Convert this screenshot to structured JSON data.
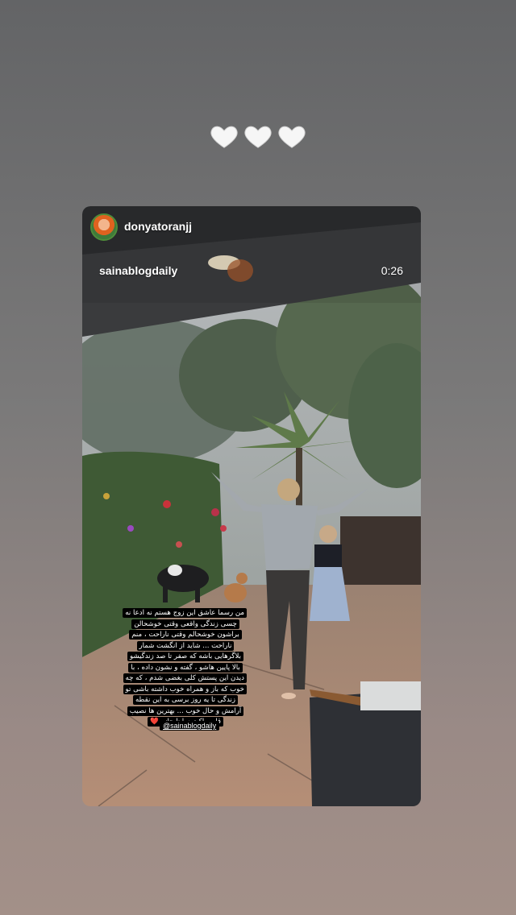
{
  "story": {
    "top_emojis": [
      "white-heart",
      "white-heart",
      "white-heart"
    ],
    "shared_post": {
      "username": "donyatoranjj",
      "source_account": "sainablogdaily",
      "timer": "0:26",
      "caption": "من رسما عاشق این زوج هستم نه ادعا نه چسی زندگی واقعی وقتی خوشحالن براشون خوشحالم وقتی ناراحت ، منم ناراحت ... شاید از انگشت شمار بلاگرهایی باشه که صفر تا صد زندگیشو بالا پایین هاشو ، گفته و نشون داده ، با دیدن این پستش کلی بغضی شدم ، که چه خوب که باز و همراه خوب داشته باشی تو زندگی تا یه روز برسی به این نقطه آرامش و حال خوب ... بهترین ها نصیب قلب پاکت ساینا جانم ❤️",
      "mention": "@sainablogdaily"
    }
  },
  "colors": {
    "background_top": "#636466",
    "background_bottom": "#a39088",
    "text": "#ffffff",
    "caption_bg": "#000000"
  }
}
